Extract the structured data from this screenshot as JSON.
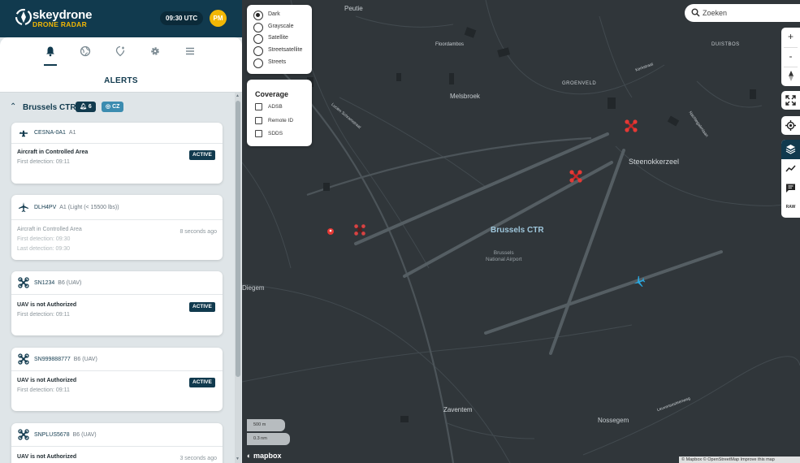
{
  "header": {
    "brand_name": "skeydrone",
    "brand_sub": "DRONE RADAR",
    "clock": "09:30 UTC",
    "avatar_initials": "PM",
    "colors": {
      "header_bg": "#113a4e",
      "accent": "#f2b705"
    }
  },
  "tabs": [
    {
      "name": "alerts",
      "icon": "bell-icon"
    },
    {
      "name": "globe",
      "icon": "globe-icon"
    },
    {
      "name": "zones",
      "icon": "zone-icon"
    },
    {
      "name": "settings",
      "icon": "gear-icon"
    },
    {
      "name": "menu",
      "icon": "menu-icon"
    }
  ],
  "alerts_title": "ALERTS",
  "group": {
    "name": "Brussels CTR",
    "count": "6",
    "zone": "CZ"
  },
  "alerts": [
    {
      "id": "CESNA-0A1",
      "class": "A1",
      "icon": "aircraft-icon",
      "title": "Aircraft in Controlled Area",
      "lines": [
        "First detection: 09:11"
      ],
      "badge": "ACTIVE",
      "ago": ""
    },
    {
      "id": "DLH4PV",
      "class": "A1 (Light (< 15500 lbs))",
      "icon": "airplane-icon",
      "title": "Aircraft in Controlled Area",
      "lines": [
        "First detection: 09:30",
        "Last detection: 09:30"
      ],
      "badge": "",
      "ago": "8 seconds ago"
    },
    {
      "id": "SN1234",
      "class": "B6 (UAV)",
      "icon": "drone-icon",
      "title": "UAV is not Authorized",
      "lines": [
        "First detection: 09:11"
      ],
      "badge": "ACTIVE",
      "ago": ""
    },
    {
      "id": "SN999888777",
      "class": "B6 (UAV)",
      "icon": "drone-icon",
      "title": "UAV is not Authorized",
      "lines": [
        "First detection: 09:11"
      ],
      "badge": "ACTIVE",
      "ago": ""
    },
    {
      "id": "SNPLUS5678",
      "class": "B6 (UAV)",
      "icon": "drone-icon",
      "title": "UAV is not Authorized",
      "lines": [],
      "badge": "",
      "ago": "3 seconds ago"
    }
  ],
  "map_style": {
    "options": [
      "Dark",
      "Grayscale",
      "Satellite",
      "Streetsatellite",
      "Streets"
    ],
    "selected": "Dark"
  },
  "coverage": {
    "title": "Coverage",
    "options": [
      "ADSB",
      "Remote ID",
      "SDDS"
    ]
  },
  "search": {
    "placeholder": "Zoeken",
    "value": ""
  },
  "controls": {
    "zoom_in": "+",
    "zoom_out": "-",
    "raw": "RAW"
  },
  "map_labels": {
    "peutie": "Peutie",
    "floordambos": "Floordambos",
    "duisberg": "DUISTBOS",
    "melsbroek": "Melsbroek",
    "groenveld": "GROENVELD",
    "steenokkerzeel": "Steenokkerzeel",
    "diegem": "Diegem",
    "zaventem": "Zaventem",
    "nossegem": "Nossegem",
    "ctr": "Brussels CTR",
    "airport_line1": "Brussels",
    "airport_line2": "National Airport",
    "kerkstraat": "Kerkstraat",
    "nachtegaal": "Nachtegalenlaan",
    "lucien": "Lucien Schramstraat",
    "leuvens": "Leuvensesteenweg"
  },
  "scale": {
    "metric": "500 m",
    "nautical": "0.3 nm"
  },
  "mapbox_logo": "mapbox",
  "attribution": "© Mapbox © OpenStreetMap Improve this map"
}
